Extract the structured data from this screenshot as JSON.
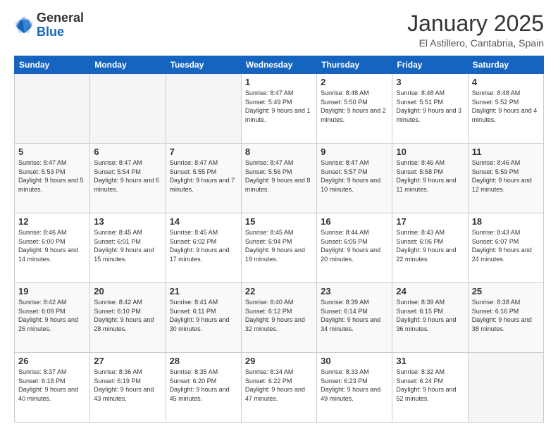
{
  "logo": {
    "general": "General",
    "blue": "Blue"
  },
  "header": {
    "month": "January 2025",
    "location": "El Astillero, Cantabria, Spain"
  },
  "weekdays": [
    "Sunday",
    "Monday",
    "Tuesday",
    "Wednesday",
    "Thursday",
    "Friday",
    "Saturday"
  ],
  "weeks": [
    [
      {
        "day": "",
        "empty": true
      },
      {
        "day": "",
        "empty": true
      },
      {
        "day": "",
        "empty": true
      },
      {
        "day": "1",
        "sunrise": "8:47 AM",
        "sunset": "5:49 PM",
        "daylight": "9 hours and 1 minute."
      },
      {
        "day": "2",
        "sunrise": "8:48 AM",
        "sunset": "5:50 PM",
        "daylight": "9 hours and 2 minutes."
      },
      {
        "day": "3",
        "sunrise": "8:48 AM",
        "sunset": "5:51 PM",
        "daylight": "9 hours and 3 minutes."
      },
      {
        "day": "4",
        "sunrise": "8:48 AM",
        "sunset": "5:52 PM",
        "daylight": "9 hours and 4 minutes."
      }
    ],
    [
      {
        "day": "5",
        "sunrise": "8:47 AM",
        "sunset": "5:53 PM",
        "daylight": "9 hours and 5 minutes."
      },
      {
        "day": "6",
        "sunrise": "8:47 AM",
        "sunset": "5:54 PM",
        "daylight": "9 hours and 6 minutes."
      },
      {
        "day": "7",
        "sunrise": "8:47 AM",
        "sunset": "5:55 PM",
        "daylight": "9 hours and 7 minutes."
      },
      {
        "day": "8",
        "sunrise": "8:47 AM",
        "sunset": "5:56 PM",
        "daylight": "9 hours and 8 minutes."
      },
      {
        "day": "9",
        "sunrise": "8:47 AM",
        "sunset": "5:57 PM",
        "daylight": "9 hours and 10 minutes."
      },
      {
        "day": "10",
        "sunrise": "8:46 AM",
        "sunset": "5:58 PM",
        "daylight": "9 hours and 11 minutes."
      },
      {
        "day": "11",
        "sunrise": "8:46 AM",
        "sunset": "5:59 PM",
        "daylight": "9 hours and 12 minutes."
      }
    ],
    [
      {
        "day": "12",
        "sunrise": "8:46 AM",
        "sunset": "6:00 PM",
        "daylight": "9 hours and 14 minutes."
      },
      {
        "day": "13",
        "sunrise": "8:45 AM",
        "sunset": "6:01 PM",
        "daylight": "9 hours and 15 minutes."
      },
      {
        "day": "14",
        "sunrise": "8:45 AM",
        "sunset": "6:02 PM",
        "daylight": "9 hours and 17 minutes."
      },
      {
        "day": "15",
        "sunrise": "8:45 AM",
        "sunset": "6:04 PM",
        "daylight": "9 hours and 19 minutes."
      },
      {
        "day": "16",
        "sunrise": "8:44 AM",
        "sunset": "6:05 PM",
        "daylight": "9 hours and 20 minutes."
      },
      {
        "day": "17",
        "sunrise": "8:43 AM",
        "sunset": "6:06 PM",
        "daylight": "9 hours and 22 minutes."
      },
      {
        "day": "18",
        "sunrise": "8:43 AM",
        "sunset": "6:07 PM",
        "daylight": "9 hours and 24 minutes."
      }
    ],
    [
      {
        "day": "19",
        "sunrise": "8:42 AM",
        "sunset": "6:09 PM",
        "daylight": "9 hours and 26 minutes."
      },
      {
        "day": "20",
        "sunrise": "8:42 AM",
        "sunset": "6:10 PM",
        "daylight": "9 hours and 28 minutes."
      },
      {
        "day": "21",
        "sunrise": "8:41 AM",
        "sunset": "6:11 PM",
        "daylight": "9 hours and 30 minutes."
      },
      {
        "day": "22",
        "sunrise": "8:40 AM",
        "sunset": "6:12 PM",
        "daylight": "9 hours and 32 minutes."
      },
      {
        "day": "23",
        "sunrise": "8:39 AM",
        "sunset": "6:14 PM",
        "daylight": "9 hours and 34 minutes."
      },
      {
        "day": "24",
        "sunrise": "8:39 AM",
        "sunset": "6:15 PM",
        "daylight": "9 hours and 36 minutes."
      },
      {
        "day": "25",
        "sunrise": "8:38 AM",
        "sunset": "6:16 PM",
        "daylight": "9 hours and 38 minutes."
      }
    ],
    [
      {
        "day": "26",
        "sunrise": "8:37 AM",
        "sunset": "6:18 PM",
        "daylight": "9 hours and 40 minutes."
      },
      {
        "day": "27",
        "sunrise": "8:36 AM",
        "sunset": "6:19 PM",
        "daylight": "9 hours and 43 minutes."
      },
      {
        "day": "28",
        "sunrise": "8:35 AM",
        "sunset": "6:20 PM",
        "daylight": "9 hours and 45 minutes."
      },
      {
        "day": "29",
        "sunrise": "8:34 AM",
        "sunset": "6:22 PM",
        "daylight": "9 hours and 47 minutes."
      },
      {
        "day": "30",
        "sunrise": "8:33 AM",
        "sunset": "6:23 PM",
        "daylight": "9 hours and 49 minutes."
      },
      {
        "day": "31",
        "sunrise": "8:32 AM",
        "sunset": "6:24 PM",
        "daylight": "9 hours and 52 minutes."
      },
      {
        "day": "",
        "empty": true
      }
    ]
  ]
}
